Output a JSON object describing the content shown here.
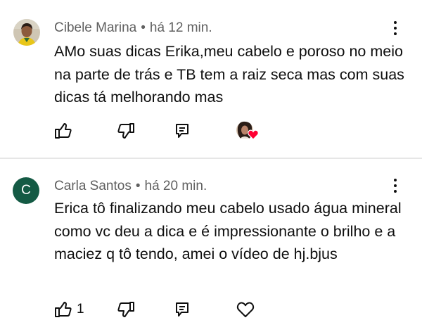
{
  "comments": [
    {
      "author": "Cibele Marina",
      "separator": "•",
      "time": "há 12 min.",
      "text": "AMo suas dicas Erika,meu cabelo e poroso no meio na parte de trás e TB tem a raiz seca mas com suas dicas tá melhorando mas",
      "like_count": "",
      "hearted": true
    },
    {
      "author": "Carla Santos",
      "avatar_letter": "C",
      "avatar_color": "#145a44",
      "separator": "•",
      "time": "há 20 min.",
      "text": "Erica tô finalizando meu cabelo usado água mineral como vc deu a dica e é impressionante o brilho e a maciez q tô tendo, amei o vídeo de hj.bjus",
      "like_count": "1",
      "hearted": false
    }
  ]
}
